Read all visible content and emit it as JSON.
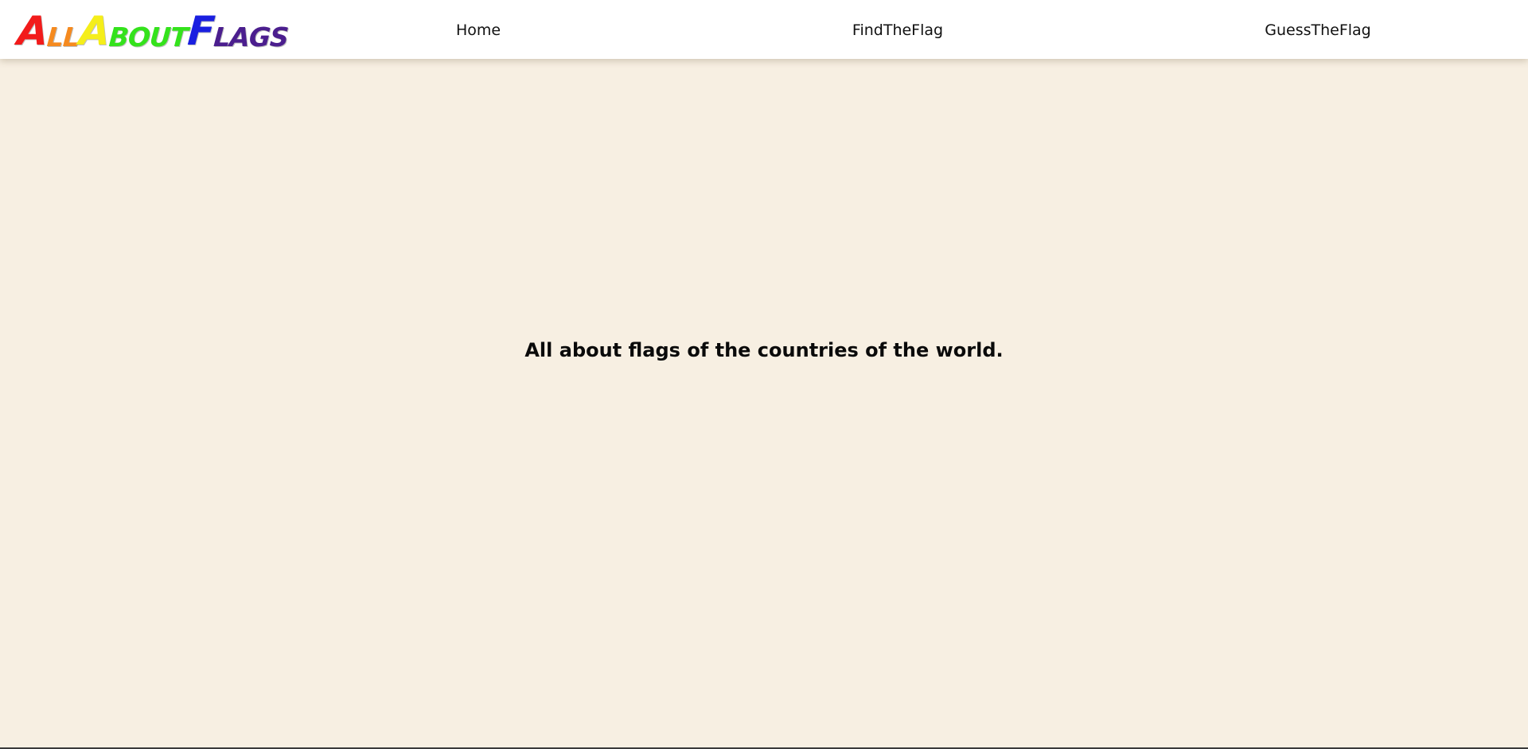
{
  "header": {
    "logo": {
      "letters": [
        {
          "text": "A",
          "size": "cap",
          "color": "#F21B1B"
        },
        {
          "text": "LL",
          "size": "sm",
          "color": "#F58A1F"
        },
        {
          "text": "A",
          "size": "cap",
          "color": "#F5EE1A"
        },
        {
          "text": "BOUT",
          "size": "sm",
          "color": "#34E21C"
        },
        {
          "text": "F",
          "size": "cap",
          "color": "#1A1FE0"
        },
        {
          "text": "LAGS",
          "size": "sm",
          "color": "#4B1E8E"
        }
      ]
    },
    "nav": {
      "home": "Home",
      "find": "FindTheFlag",
      "guess": "GuessTheFlag"
    }
  },
  "main": {
    "headline": "All about flags of the countries of the world."
  },
  "colors": {
    "background": "#F7EFE2",
    "header_bg": "#FFFFFF",
    "text": "#0A0A0A"
  }
}
